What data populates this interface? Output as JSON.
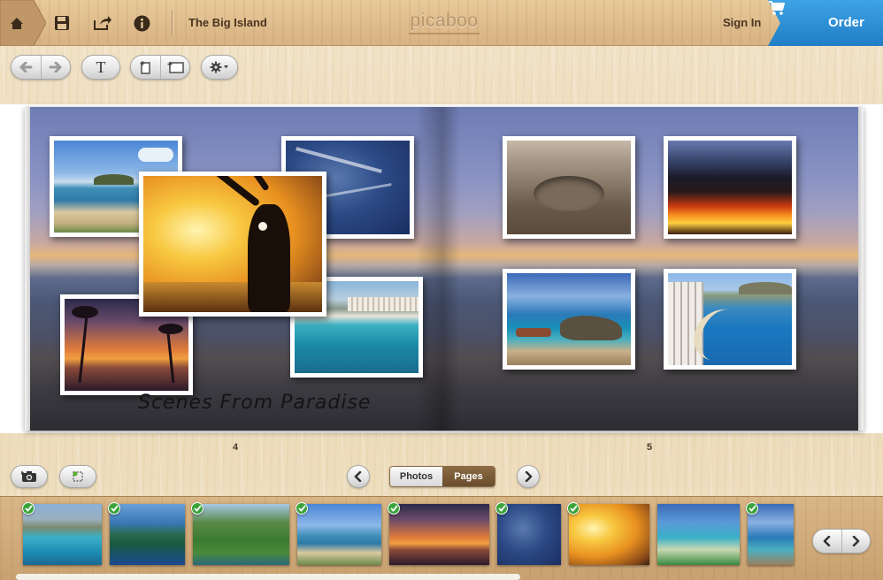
{
  "header": {
    "title": "The Big Island",
    "logo": "picaboo",
    "sign_in": "Sign In",
    "order": "Order"
  },
  "toolbar": {
    "text_tool": "T"
  },
  "book": {
    "caption": "Scenes From Paradise",
    "left_page_number": "4",
    "right_page_number": "5"
  },
  "bottom": {
    "view_toggle": {
      "photos": "Photos",
      "pages": "Pages",
      "selected": "Pages"
    }
  },
  "colors": {
    "order_blue": "#2a8fd6",
    "check_green": "#3aa43a",
    "pages_active": "#6a4d2c"
  },
  "icons": [
    "home-icon",
    "save-icon",
    "share-icon",
    "info-icon",
    "cart-icon",
    "undo-icon",
    "redo-icon",
    "text-icon",
    "add-page-icon",
    "add-layout-icon",
    "gear-icon",
    "camera-icon",
    "select-icon",
    "chevron-left-icon",
    "chevron-right-icon",
    "check-icon"
  ],
  "filmstrip": {
    "thumbnails": [
      {
        "name": "honolulu-coast",
        "used": true
      },
      {
        "name": "sea-cliffs",
        "used": true
      },
      {
        "name": "green-valley",
        "used": true
      },
      {
        "name": "beach-island",
        "used": true
      },
      {
        "name": "palm-sunset",
        "used": true
      },
      {
        "name": "aerial-ocean",
        "used": true
      },
      {
        "name": "hula-sunset",
        "used": true
      },
      {
        "name": "waikiki-resort",
        "used": false
      },
      {
        "name": "rocky-cove",
        "used": true
      }
    ]
  }
}
